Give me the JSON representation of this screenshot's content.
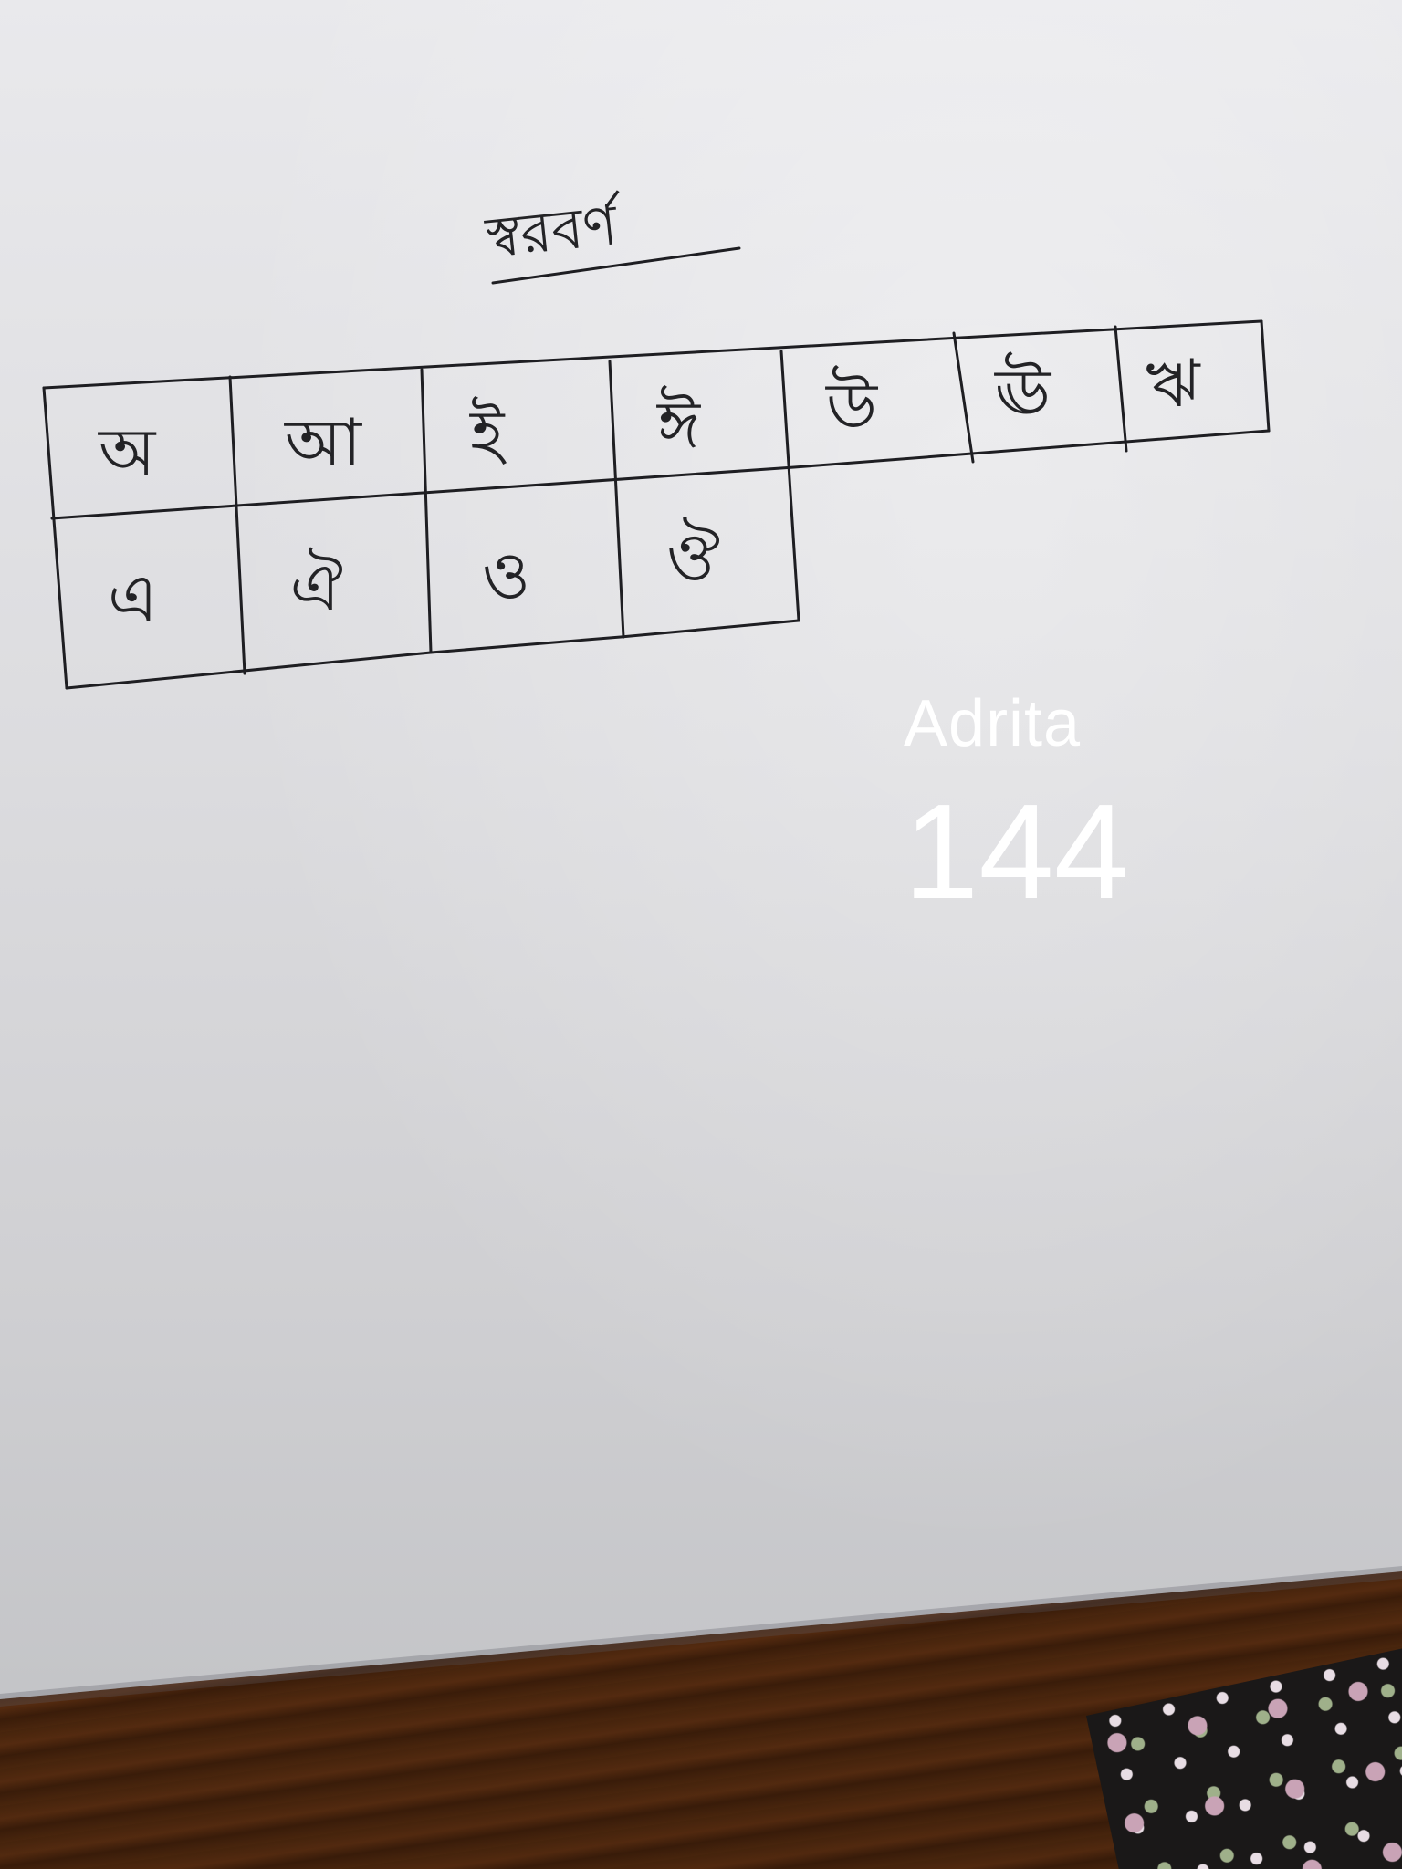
{
  "photo": {
    "heading": "স্বরবর্ণ",
    "table": {
      "row1": [
        "অ",
        "আ",
        "ই",
        "ঈ",
        "উ",
        "ঊ",
        "ঋ"
      ],
      "row2": [
        "এ",
        "ঐ",
        "ও",
        "ঔ"
      ]
    }
  },
  "overlay": {
    "name": "Adrita",
    "number": "144"
  },
  "colors": {
    "paper": "#dcdcdf",
    "ink": "#1e1e22",
    "table_wood": "#5a2e10",
    "overlay_text": "#ffffff"
  }
}
